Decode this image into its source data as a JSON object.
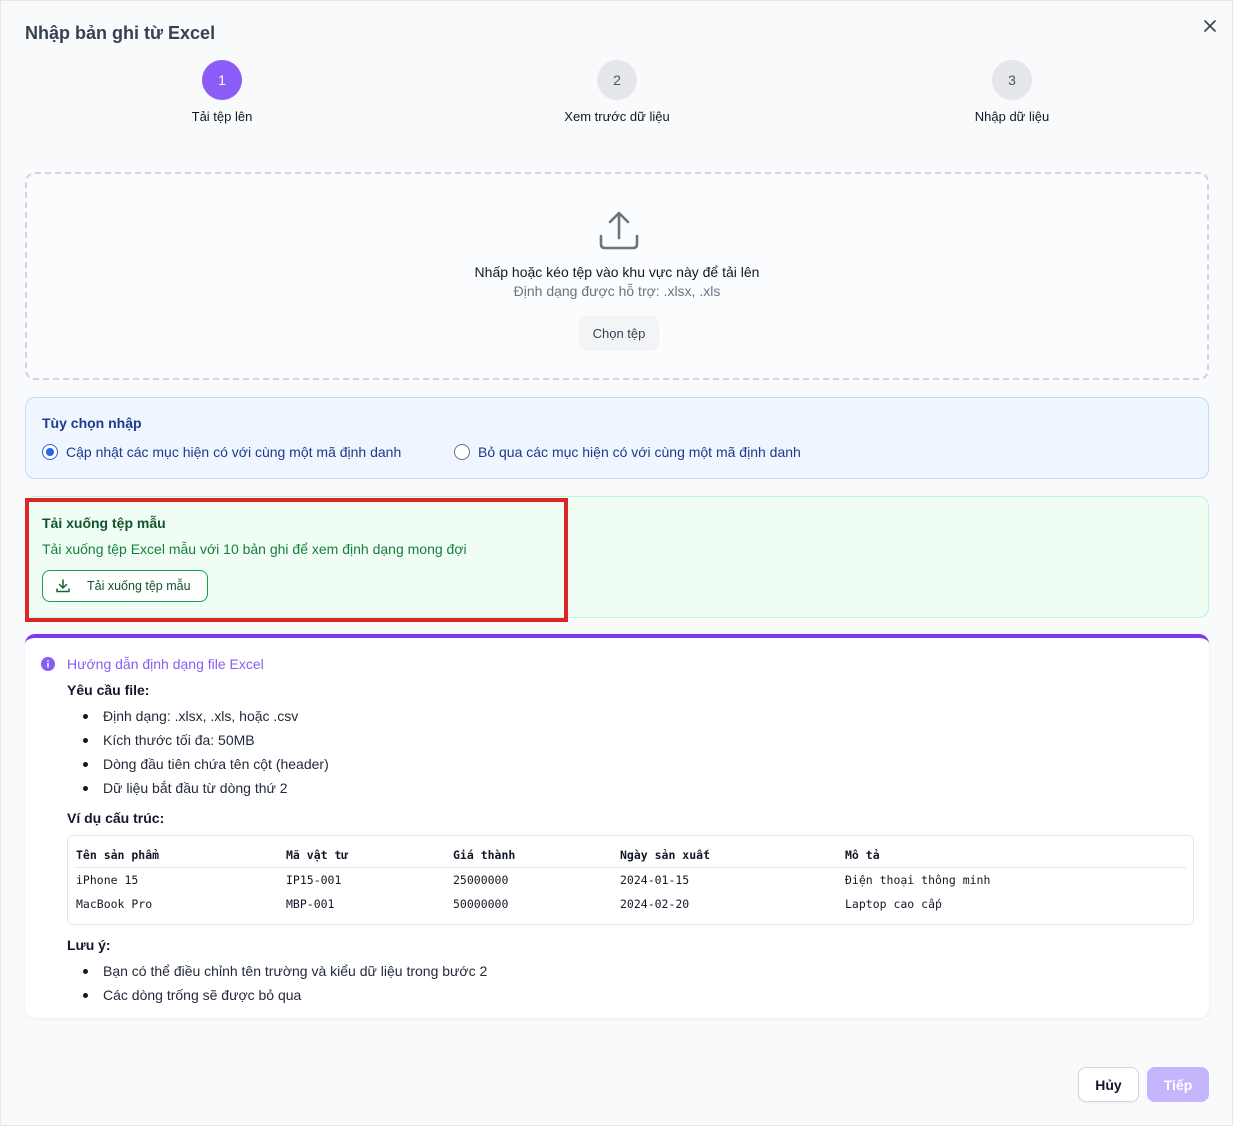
{
  "dialog": {
    "title": "Nhập bản ghi từ Excel"
  },
  "stepper": {
    "steps": [
      {
        "number": "1",
        "label": "Tải tệp lên",
        "state": "active"
      },
      {
        "number": "2",
        "label": "Xem trước dữ liệu",
        "state": "pending"
      },
      {
        "number": "3",
        "label": "Nhập dữ liệu",
        "state": "pending"
      }
    ]
  },
  "upload": {
    "prompt": "Nhấp hoặc kéo tệp vào khu vực này để tải lên",
    "formats": "Định dạng được hỗ trợ: .xlsx, .xls",
    "choose_label": "Chọn tệp"
  },
  "import_options": {
    "heading": "Tùy chọn nhập",
    "options": [
      {
        "label": "Cập nhật các mục hiện có với cùng một mã định danh",
        "checked": true
      },
      {
        "label": "Bỏ qua các mục hiện có với cùng một mã định danh",
        "checked": false
      }
    ]
  },
  "template": {
    "heading": "Tải xuống tệp mẫu",
    "description": "Tải xuống tệp Excel mẫu với 10 bản ghi để xem định dạng mong đợi",
    "button_label": "Tải xuống tệp mẫu"
  },
  "guide": {
    "title": "Hướng dẫn định dạng file Excel",
    "requirements_heading": "Yêu cầu file:",
    "requirements": [
      "Định dạng: .xlsx, .xls, hoặc .csv",
      "Kích thước tối đa: 50MB",
      "Dòng đầu tiên chứa tên cột (header)",
      "Dữ liệu bắt đầu từ dòng thứ 2"
    ],
    "example_heading": "Ví dụ cấu trúc:",
    "table": {
      "headers": [
        "Tên sản phẩm",
        "Mã vật tư",
        "Giá thành",
        "Ngày sản xuất",
        "Mô tả"
      ],
      "rows": [
        [
          "iPhone 15",
          "IP15-001",
          "25000000",
          "2024-01-15",
          "Điện thoại thông minh"
        ],
        [
          "MacBook Pro",
          "MBP-001",
          "50000000",
          "2024-02-20",
          "Laptop cao cấp"
        ]
      ]
    },
    "notes_heading": "Lưu ý:",
    "notes": [
      "Bạn có thể điều chỉnh tên trường và kiểu dữ liệu trong bước 2",
      "Các dòng trống sẽ được bỏ qua"
    ]
  },
  "footer": {
    "cancel_label": "Hủy",
    "next_label": "Tiếp"
  },
  "colors": {
    "accent": "#8b5cf6",
    "highlight_border": "#dc2626",
    "success": "#16a34a",
    "info": "#2563eb"
  }
}
